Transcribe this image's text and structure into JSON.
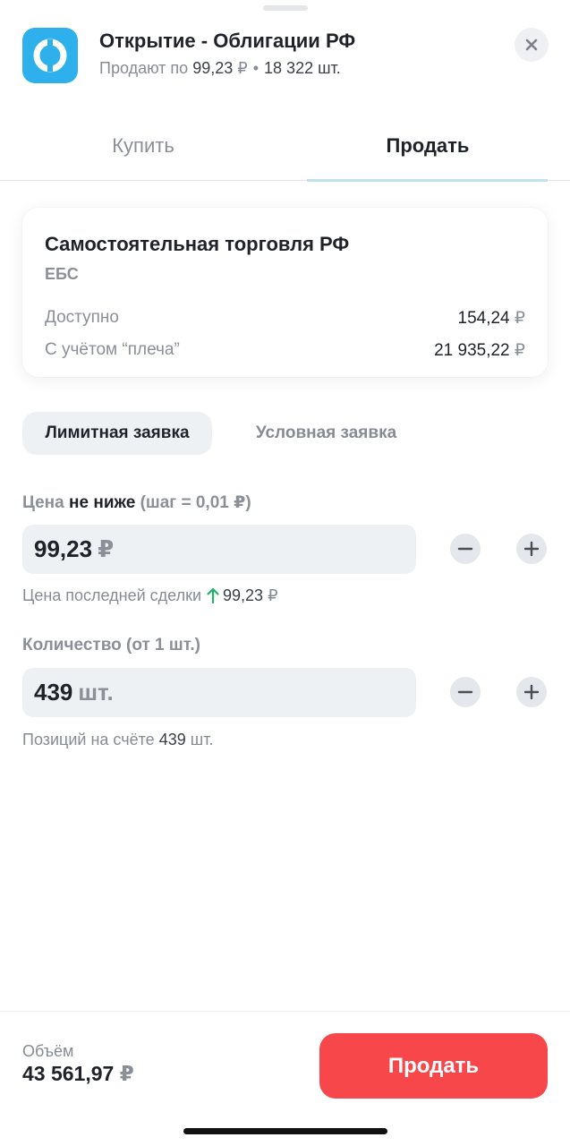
{
  "header": {
    "title": "Открытие - Облигации РФ",
    "subtitle_prefix": "Продают по",
    "price": "99,23",
    "price_currency": "₽",
    "quantity": "18 322 шт.",
    "logo_icon": "otkritie-logo-icon",
    "close_icon": "close-icon"
  },
  "tabs": [
    {
      "label": "Купить",
      "active": false
    },
    {
      "label": "Продать",
      "active": true
    }
  ],
  "account": {
    "title": "Самостоятельная торговля РФ",
    "subtitle": "ЕБС",
    "available_label": "Доступно",
    "available_value": "154,24",
    "leverage_label": "С учётом “плеча”",
    "leverage_value": "21 935,22",
    "currency": "₽"
  },
  "order_types": {
    "active": "Лимитная заявка",
    "inactive": "Условная заявка"
  },
  "price_field": {
    "label_prefix": "Цена",
    "label_strong": "не ниже",
    "label_suffix": "(шаг = 0,01 ₽)",
    "value": "99,23",
    "unit": "₽",
    "hint_label": "Цена последней сделки",
    "hint_value": "99,23",
    "hint_unit": "₽",
    "trend_icon": "arrow-up-icon",
    "trend_color": "#21b36b"
  },
  "quantity_field": {
    "label": "Количество (от 1 шт.)",
    "value": "439",
    "unit": "шт.",
    "hint_label": "Позиций на счёте",
    "hint_value": "439",
    "hint_unit": "шт."
  },
  "footer": {
    "volume_label": "Объём",
    "volume_value": "43 561,97",
    "volume_currency": "₽",
    "sell_button": "Продать",
    "sell_color": "#f7474a"
  }
}
